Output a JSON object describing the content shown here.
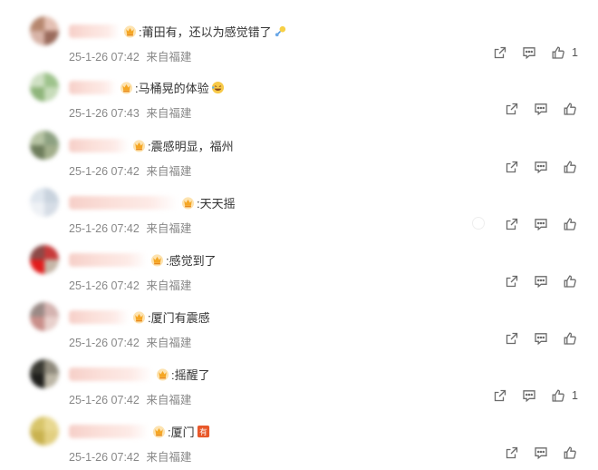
{
  "comments": [
    {
      "text": ":莆田有，还以为感觉错了",
      "emoji": "wind-chime",
      "time": "25-1-26 07:42",
      "location": "来自福建",
      "likes": "1",
      "name_w": 56,
      "avatar": [
        "#b6876f",
        "#e4c0b3",
        "#d8b4a8",
        "#9a6b5c"
      ],
      "actions_right": 641,
      "show_faint": false
    },
    {
      "text": ":马桶晃的体验",
      "emoji": "laughing-face",
      "time": "25-1-26 07:43",
      "location": "来自福建",
      "likes": "",
      "name_w": 52,
      "avatar": [
        "#cfe0c4",
        "#9ec38c",
        "#8fb57b",
        "#c7dcba"
      ],
      "actions_right": 640,
      "show_faint": false
    },
    {
      "text": ":震感明显，福州",
      "emoji": "",
      "time": "25-1-26 07:42",
      "location": "来自福建",
      "likes": "",
      "name_w": 66,
      "avatar": [
        "#b7c4a4",
        "#8da181",
        "#6e7d5c",
        "#a2ae8b"
      ],
      "actions_right": 640,
      "show_faint": false
    },
    {
      "text": ":天天摇",
      "emoji": "",
      "time": "25-1-26 07:42",
      "location": "来自福建",
      "likes": "",
      "name_w": 120,
      "avatar": [
        "#dfe6ee",
        "#c9d3de",
        "#eef1f5",
        "#d6dde6"
      ],
      "actions_right": 640,
      "show_faint": true
    },
    {
      "text": ":感觉到了",
      "emoji": "",
      "time": "25-1-26 07:42",
      "location": "来自福建",
      "likes": "",
      "name_w": 86,
      "avatar": [
        "#8c4a48",
        "#c83a3a",
        "#e21c1c",
        "#c6b7a8"
      ],
      "actions_right": 640,
      "show_faint": false
    },
    {
      "text": ":厦门有震感",
      "emoji": "",
      "time": "25-1-26 07:42",
      "location": "来自福建",
      "likes": "",
      "name_w": 66,
      "avatar": [
        "#9a8a86",
        "#d4b3b0",
        "#c98f8a",
        "#e8d0cc"
      ],
      "actions_right": 640,
      "show_faint": false
    },
    {
      "text": ":摇醒了",
      "emoji": "",
      "time": "25-1-26 07:42",
      "location": "来自福建",
      "likes": "1",
      "name_w": 92,
      "avatar": [
        "#3a3a33",
        "#8f8a7c",
        "#1f1f1c",
        "#bcb6a6"
      ],
      "actions_right": 641,
      "show_faint": false
    },
    {
      "text": ":厦门",
      "emoji": "you-badge",
      "time": "25-1-26 07:42",
      "location": "来自福建",
      "likes": "",
      "name_w": 88,
      "avatar": [
        "#d8c56a",
        "#e8d890",
        "#c9b24f",
        "#e2cf80"
      ],
      "actions_right": 640,
      "show_faint": false
    }
  ],
  "icons": {
    "badge": "crown-badge-icon",
    "share": "share-icon",
    "reply": "comment-icon",
    "like": "thumbs-up-icon"
  },
  "colors": {
    "meta": "#888888",
    "icon": "#666666",
    "name_blur": "#f6cfc8",
    "badge": "#f5a623"
  }
}
